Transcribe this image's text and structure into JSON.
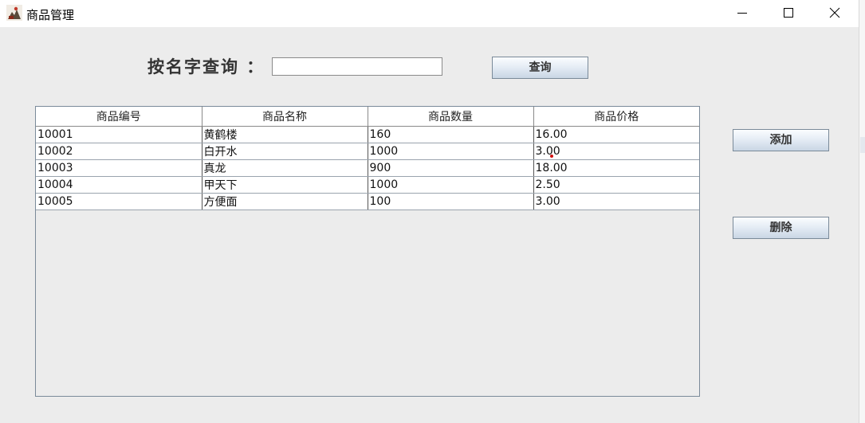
{
  "window": {
    "title": "商品管理",
    "controls": [
      "minimize-icon",
      "maximize-icon",
      "close-icon"
    ]
  },
  "search": {
    "label": "按名字查询 ：",
    "value": "",
    "button_label": "查询"
  },
  "table": {
    "columns": [
      "商品编号",
      "商品名称",
      "商品数量",
      "商品价格"
    ],
    "rows": [
      [
        "10001",
        "黄鹤楼",
        "160",
        "16.00"
      ],
      [
        "10002",
        "白开水",
        "1000",
        "3.00"
      ],
      [
        "10003",
        "真龙",
        "900",
        "18.00"
      ],
      [
        "10004",
        "甲天下",
        "1000",
        "2.50"
      ],
      [
        "10005",
        "方便面",
        "100",
        "3.00"
      ]
    ]
  },
  "actions": {
    "add_label": "添加",
    "delete_label": "删除"
  },
  "colors": {
    "content_bg": "#ececec",
    "button_border": "#7a8a99"
  }
}
